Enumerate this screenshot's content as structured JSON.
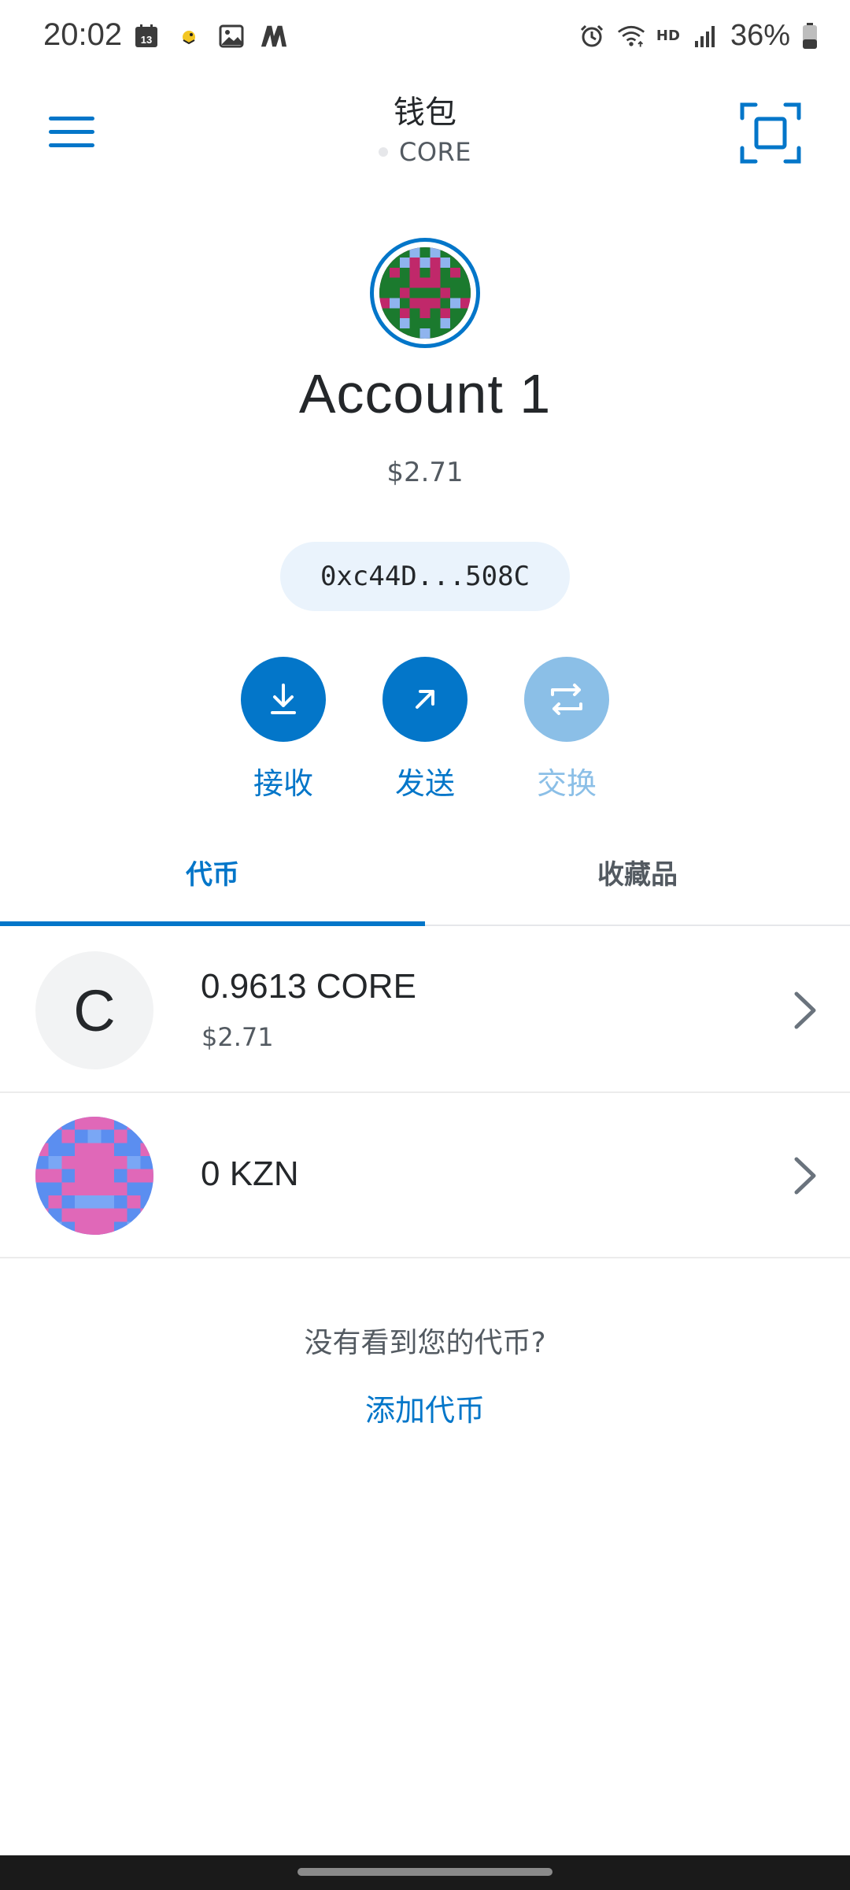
{
  "status_bar": {
    "time": "20:02",
    "calendar_day": "13",
    "network_type": "HD",
    "battery_percent": "36%"
  },
  "header": {
    "title": "钱包",
    "network": "CORE"
  },
  "account": {
    "name": "Account 1",
    "balance": "$2.71",
    "address": "0xc44D...508C"
  },
  "actions": [
    {
      "label": "接收",
      "icon": "download-icon"
    },
    {
      "label": "发送",
      "icon": "arrow-up-right-icon"
    },
    {
      "label": "交换",
      "icon": "swap-icon"
    }
  ],
  "tabs": {
    "tokens": "代币",
    "collectibles": "收藏品"
  },
  "tokens": [
    {
      "letter": "C",
      "amount": "0.9613 CORE",
      "fiat": "$2.71"
    },
    {
      "amount": "0 KZN",
      "fiat": ""
    }
  ],
  "footer": {
    "prompt": "没有看到您的代币?",
    "add_link": "添加代币"
  },
  "colors": {
    "accent": "#0376c9",
    "accent_disabled": "#8bbfe7",
    "pill_bg": "#eaf3fc"
  }
}
